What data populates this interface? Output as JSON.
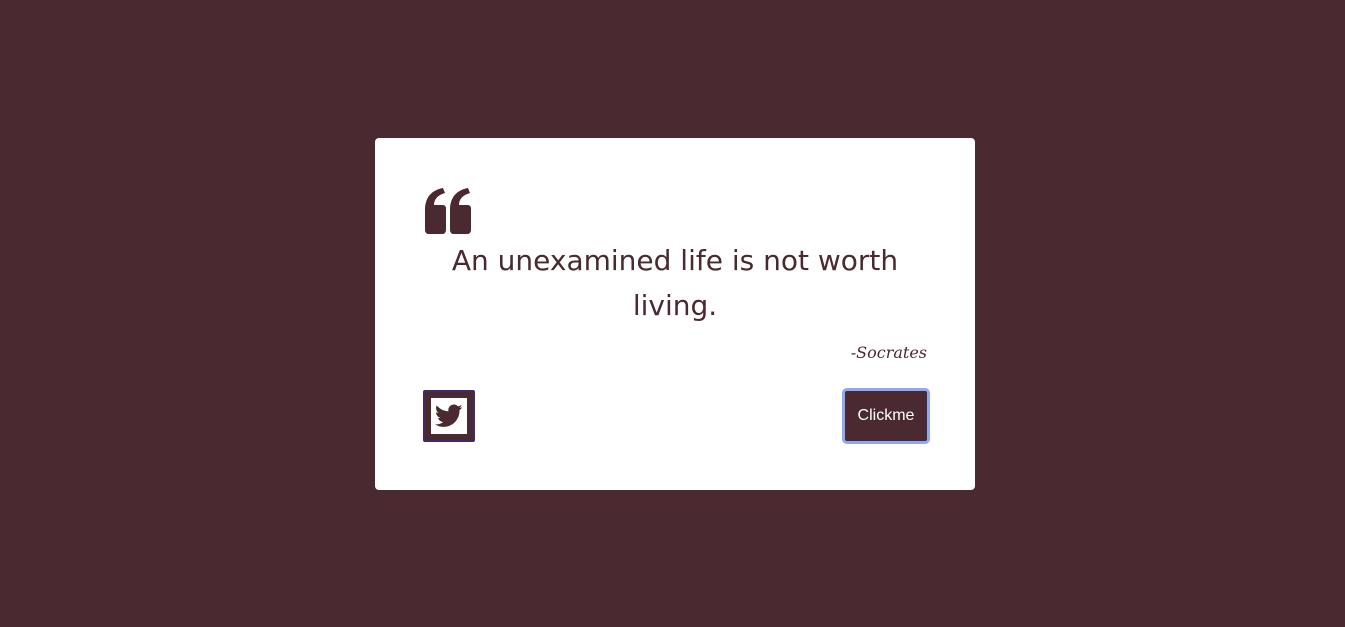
{
  "quote": {
    "text": "An unexamined life is not worth living.",
    "author": "-Socrates",
    "icon": "quote-left-icon"
  },
  "actions": {
    "tweet_icon": "twitter-icon",
    "button_label": "Clickme"
  },
  "colors": {
    "background": "#4a2930",
    "card": "#ffffff",
    "accent": "#4a2930",
    "focus_ring": "#8fa8ee"
  }
}
